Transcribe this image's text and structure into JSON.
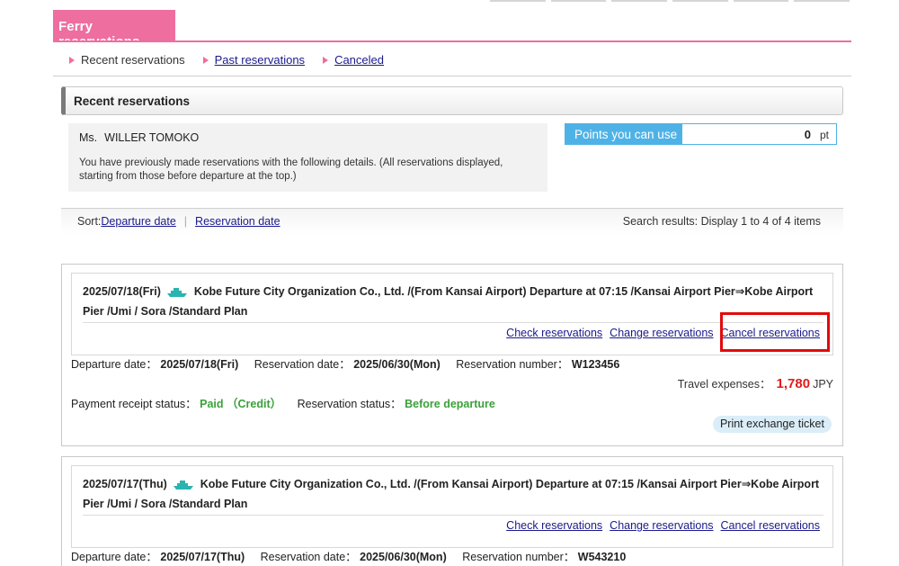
{
  "page": {
    "title": "Ferry reservations"
  },
  "subnav": {
    "current": "Recent reservations",
    "past": "Past reservations",
    "canceled": "Canceled"
  },
  "section": {
    "title": "Recent reservations"
  },
  "customer": {
    "salutation": "Ms.",
    "name": "WILLER TOMOKO",
    "description": "You have previously made reservations with the following details. (All reservations displayed, starting from those before departure at the top.)"
  },
  "points": {
    "label": "Points you can use",
    "value": "0",
    "unit": "pt"
  },
  "sort": {
    "prefix": "Sort:",
    "departure": "Departure date",
    "separator": "|",
    "reservation": "Reservation date",
    "results": "Search results: Display 1 to 4 of 4 items"
  },
  "labels": {
    "departure_date": "Departure date：",
    "reservation_date": "Reservation date：",
    "reservation_number": "Reservation number：",
    "travel_expenses": "Travel expenses：",
    "payment_status": "Payment receipt status：",
    "reservation_status": "Reservation status：",
    "check": "Check reservations",
    "change": "Change reservations",
    "cancel": "Cancel reservations",
    "print": "Print exchange ticket"
  },
  "reservations": [
    {
      "route_date": "2025/07/18(Fri)",
      "route_text": "Kobe Future City Organization Co., Ltd. /(From Kansai Airport) Departure at 07:15 /Kansai Airport Pier⇒Kobe Airport Pier /Umi / Sora /Standard Plan",
      "departure_date": "2025/07/18(Fri)",
      "reservation_date": "2025/06/30(Mon)",
      "reservation_number": "W123456",
      "amount": "1,780",
      "currency": "JPY",
      "payment_status": "Paid （Credit）",
      "reservation_status": "Before departure"
    },
    {
      "route_date": "2025/07/17(Thu)",
      "route_text": "Kobe Future City Organization Co., Ltd. /(From Kansai Airport) Departure at 07:15 /Kansai Airport Pier⇒Kobe Airport Pier /Umi / Sora /Standard Plan",
      "departure_date": "2025/07/17(Thu)",
      "reservation_date": "2025/06/30(Mon)",
      "reservation_number": "W543210"
    }
  ],
  "colors": {
    "brand_pink": "#ee6e9f",
    "points_blue": "#4fb2e6",
    "price_red": "#e21b1b",
    "status_green": "#3aa13a",
    "highlight_red": "#e20b0b"
  }
}
